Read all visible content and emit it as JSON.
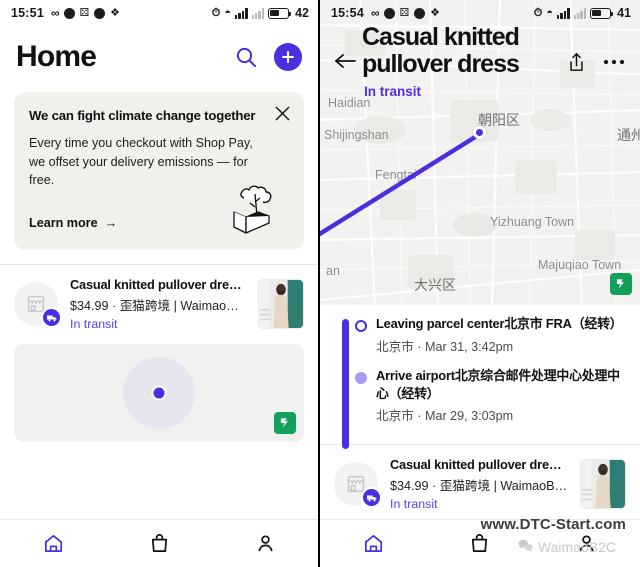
{
  "colors": {
    "accent": "#4b2ee0",
    "accent_light": "#a79af0",
    "banner_bg": "#f1f0ec",
    "map_green": "#13a05a"
  },
  "left_panel": {
    "status_bar": {
      "time": "15:51",
      "battery_percent": "42",
      "icons": [
        "infinity-icon",
        "dot-icon",
        "wechat-icon",
        "dot-icon",
        "evernote-icon",
        "alarm-icon",
        "wifi-icon",
        "signal-icon",
        "signal-dim-icon",
        "battery-icon"
      ]
    },
    "header": {
      "title": "Home",
      "search_icon": "search-icon",
      "add_icon": "plus-icon"
    },
    "climate_banner": {
      "title": "We can fight climate change together",
      "body": "Every time you checkout with Shop Pay, we offset your delivery emissions — for free.",
      "cta": "Learn more",
      "cta_arrow": "→",
      "close_icon": "close-icon",
      "illustration": "tree-in-box-icon"
    },
    "order": {
      "title": "Casual knitted pullover dress - ...",
      "subtitle": "$34.99 · 歪猫跨境 | WaimaoB2...",
      "status": "In transit",
      "store_icon": "store-icon",
      "badge_icon": "truck-icon",
      "thumbnail": "product-thumbnail"
    },
    "minimap": {
      "marker": "current-location-dot",
      "attribution": "amap-logo"
    },
    "tabbar": [
      {
        "name": "tab-home",
        "icon": "home-icon",
        "active": true
      },
      {
        "name": "tab-shop",
        "icon": "bag-icon",
        "active": false
      },
      {
        "name": "tab-profile",
        "icon": "person-icon",
        "active": false
      }
    ]
  },
  "right_panel": {
    "status_bar": {
      "time": "15:54",
      "battery_percent": "41"
    },
    "detail": {
      "title": "Casual knitted pullover dress",
      "status": "In transit",
      "back_icon": "back-arrow-icon",
      "share_icon": "share-icon",
      "more_icon": "more-horizontal-icon"
    },
    "map": {
      "labels": [
        {
          "text": "Haidian",
          "lang": "en"
        },
        {
          "text": "Shijingshan",
          "lang": "en"
        },
        {
          "text": "Fengtai",
          "lang": "en"
        },
        {
          "text": "朝阳区",
          "lang": "cn"
        },
        {
          "text": "通州",
          "lang": "cn"
        },
        {
          "text": "Yizhuang Town",
          "lang": "en"
        },
        {
          "text": "Majuqiao Town",
          "lang": "en"
        },
        {
          "text": "大兴区",
          "lang": "cn"
        },
        {
          "text": "an",
          "lang": "en"
        }
      ],
      "attribution": "amap-logo"
    },
    "timeline": [
      {
        "title": "Leaving parcel center北京市 FRA（经转）",
        "meta": "北京市 · Mar 31, 3:42pm",
        "marker": "open"
      },
      {
        "title": "Arrive airport北京综合邮件处理中心处理中心（经转）",
        "meta": "北京市 · Mar 29, 3:03pm",
        "marker": "solid"
      }
    ],
    "order": {
      "title": "Casual knitted pullover dress - ...",
      "subtitle": "$34.99 · 歪猫跨境 | WaimaoB2...",
      "status": "In transit"
    },
    "tabbar": [
      {
        "name": "tab-home",
        "icon": "home-icon",
        "active": true
      },
      {
        "name": "tab-shop",
        "icon": "bag-icon",
        "active": false
      },
      {
        "name": "tab-profile",
        "icon": "person-icon",
        "active": false
      }
    ]
  },
  "watermark": {
    "main": "www.DTC-Start.com",
    "sub": "WaimaoB2C",
    "sub_icon": "wechat-icon"
  }
}
